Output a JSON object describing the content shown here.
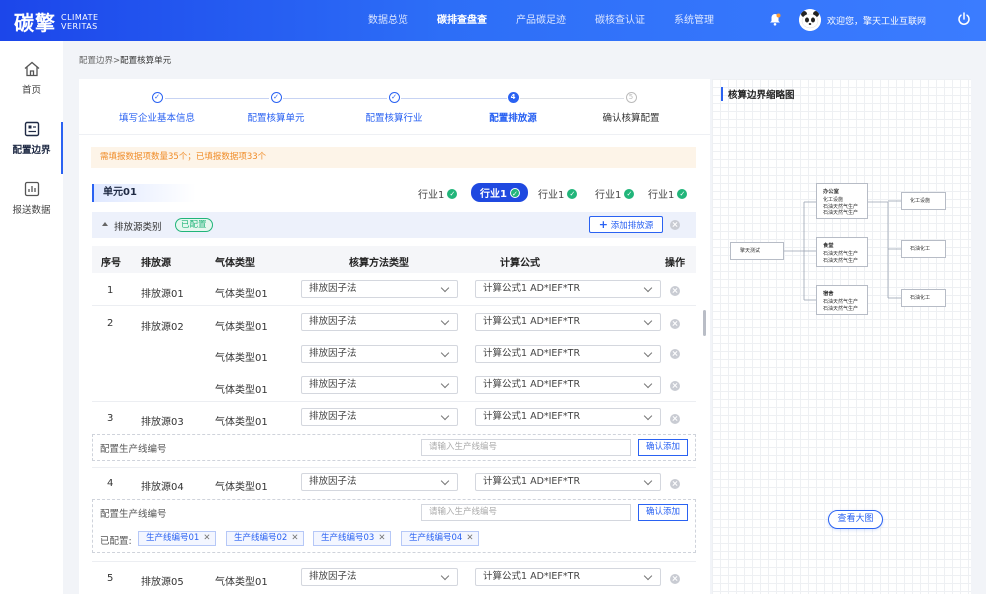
{
  "header": {
    "logo_cn": "碳擎",
    "logo_en_1": "CLIMATE",
    "logo_en_2": "VERITAS",
    "nav": [
      "数据总览",
      "碳排查盘查",
      "产品碳足迹",
      "碳核查认证",
      "系统管理"
    ],
    "nav_active_index": 1,
    "welcome": "欢迎您，擎天工业互联网"
  },
  "sidebar": {
    "items": [
      {
        "label": "首页",
        "icon": "home-icon"
      },
      {
        "label": "配置边界",
        "icon": "config-icon",
        "active": true
      },
      {
        "label": "报送数据",
        "icon": "report-icon"
      }
    ]
  },
  "breadcrumb": {
    "parent": "配置边界",
    "sep": ">",
    "current": "配置核算单元"
  },
  "steps": [
    {
      "num": "✓",
      "label": "填写企业基本信息",
      "state": "done"
    },
    {
      "num": "✓",
      "label": "配置核算单元",
      "state": "done"
    },
    {
      "num": "✓",
      "label": "配置核算行业",
      "state": "done"
    },
    {
      "num": "4",
      "label": "配置排放源",
      "state": "current"
    },
    {
      "num": "5",
      "label": "确认核算配置",
      "state": "todo"
    }
  ],
  "notice": "需填报数据项数量35个；已填报数据项33个",
  "unit_title": "单元01",
  "industries": [
    "行业1",
    "行业1",
    "行业1",
    "行业1",
    "行业1"
  ],
  "category": {
    "title": "排放源类别",
    "badge": "已配置",
    "add_button": "添加排放源"
  },
  "table": {
    "headers": [
      "序号",
      "排放源",
      "气体类型",
      "核算方法类型",
      "计算公式",
      "操作"
    ],
    "rows": [
      {
        "no": "1",
        "source": "排放源01",
        "gas": "气体类型01",
        "method": "排放因子法",
        "formula": "计算公式1 AD*IEF*TR"
      },
      {
        "no": "2",
        "source": "排放源02",
        "gas": "气体类型01",
        "method": "排放因子法",
        "formula": "计算公式1 AD*IEF*TR"
      },
      {
        "no": "",
        "source": "",
        "gas": "气体类型01",
        "method": "排放因子法",
        "formula": "计算公式1 AD*IEF*TR"
      },
      {
        "no": "",
        "source": "",
        "gas": "气体类型01",
        "method": "排放因子法",
        "formula": "计算公式1 AD*IEF*TR"
      },
      {
        "no": "3",
        "source": "排放源03",
        "gas": "气体类型01",
        "method": "排放因子法",
        "formula": "计算公式1 AD*IEF*TR"
      },
      {
        "no": "4",
        "source": "排放源04",
        "gas": "气体类型01",
        "method": "排放因子法",
        "formula": "计算公式1 AD*IEF*TR"
      },
      {
        "no": "5",
        "source": "排放源05",
        "gas": "气体类型01",
        "method": "排放因子法",
        "formula": "计算公式1 AD*IEF*TR"
      }
    ]
  },
  "production_line": {
    "label": "配置生产线编号",
    "placeholder": "请输入生产线编号",
    "confirm": "确认添加",
    "configured_label": "已配置:",
    "tags": [
      "生产线编号01",
      "生产线编号02",
      "生产线编号03",
      "生产线编号04"
    ]
  },
  "diagram": {
    "title": "核算边界缩略图",
    "root": "擎天测试",
    "groups": [
      {
        "title": "办公室",
        "items": [
          "化工设施",
          "石油天然气生产",
          "石油天然气生产"
        ]
      },
      {
        "title": "食堂",
        "items": [
          "石油天然气生产",
          "石油天然气生产"
        ]
      },
      {
        "title": "宿舍",
        "items": [
          "石油天然气生产",
          "石油天然气生产"
        ]
      }
    ],
    "leaves": [
      "化工设施",
      "石油化工",
      "石油化工"
    ],
    "view_button": "查看大图"
  },
  "colors": {
    "brand": "#2a62f2",
    "success": "#21b57a",
    "warning": "#f08c28"
  }
}
